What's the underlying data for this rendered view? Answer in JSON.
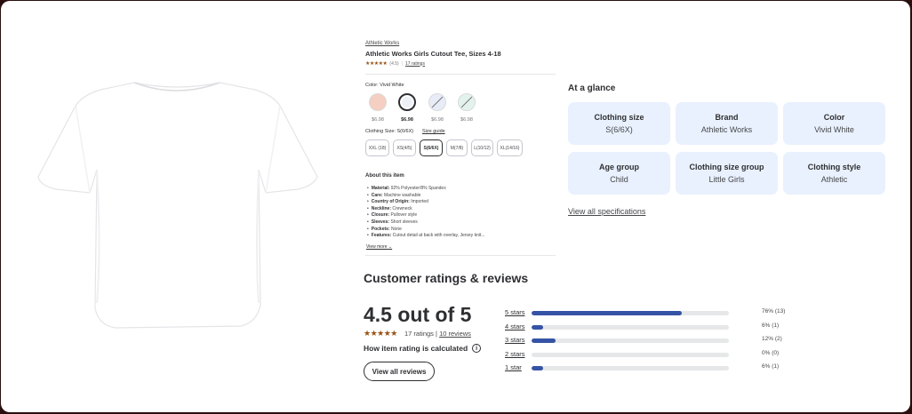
{
  "product": {
    "brand": "Athletic Works",
    "title": "Athletic Works Girls Cutout Tee, Sizes 4-18",
    "rating_short": "(4.5)",
    "ratings_link": "17 ratings"
  },
  "color": {
    "label": "Color:",
    "selected": "Vivid White",
    "swatches": [
      {
        "name": "pink",
        "color": "#f5cfc2",
        "price": "$6.98",
        "selected": false,
        "unavailable": false
      },
      {
        "name": "vivid-white",
        "color": "#eef0f8",
        "price": "$6.98",
        "selected": true,
        "unavailable": false
      },
      {
        "name": "blue",
        "color": "#e8ecf7",
        "price": "$6.98",
        "selected": false,
        "unavailable": true
      },
      {
        "name": "mint",
        "color": "#e3f3ec",
        "price": "$6.98",
        "selected": false,
        "unavailable": true
      }
    ]
  },
  "size": {
    "label": "Clothing Size:",
    "selected": "S(6/6X)",
    "guide": "Size guide",
    "options": [
      "XXL (18)",
      "XS(4/5)",
      "S(6/6X)",
      "M(7/8)",
      "L(10/12)",
      "XL(14/16)"
    ],
    "selected_index": 2
  },
  "about": {
    "title": "About this item",
    "items": [
      {
        "k": "Material:",
        "v": "92% Polyester/8% Spandex"
      },
      {
        "k": "Care:",
        "v": "Machine washable"
      },
      {
        "k": "Country of Origin:",
        "v": "Imported"
      },
      {
        "k": "Neckline:",
        "v": "Crewneck"
      },
      {
        "k": "Closure:",
        "v": "Pullover style"
      },
      {
        "k": "Sleeves:",
        "v": "Short sleeves"
      },
      {
        "k": "Pockets:",
        "v": "None"
      },
      {
        "k": "Features:",
        "v": "Cutout detail at back with overlay, Jersey knit..."
      }
    ],
    "view_more": "View more"
  },
  "glance": {
    "title": "At a glance",
    "cards": [
      {
        "k": "Clothing size",
        "v": "S(6/6X)"
      },
      {
        "k": "Brand",
        "v": "Athletic Works"
      },
      {
        "k": "Color",
        "v": "Vivid White"
      },
      {
        "k": "Age group",
        "v": "Child"
      },
      {
        "k": "Clothing size group",
        "v": "Little Girls"
      },
      {
        "k": "Clothing style",
        "v": "Athletic"
      }
    ],
    "view_all": "View all specifications"
  },
  "reviews": {
    "title": "Customer ratings & reviews",
    "average": "4.5 out of 5",
    "ratings_count": "17 ratings",
    "reviews_link": "10 reviews",
    "calc_label": "How item rating is calculated",
    "view_all_button": "View all reviews",
    "breakdown": [
      {
        "label": "5 stars",
        "pct": 76,
        "text": "76% (13)"
      },
      {
        "label": "4 stars",
        "pct": 6,
        "text": "6% (1)"
      },
      {
        "label": "3 stars",
        "pct": 12,
        "text": "12% (2)"
      },
      {
        "label": "2 stars",
        "pct": 0,
        "text": "0% (0)"
      },
      {
        "label": "1 star",
        "pct": 6,
        "text": "6% (1)"
      }
    ]
  },
  "colors": {
    "accent": "#3654a6",
    "card_bg": "#e9f1fe",
    "star": "#995213"
  }
}
